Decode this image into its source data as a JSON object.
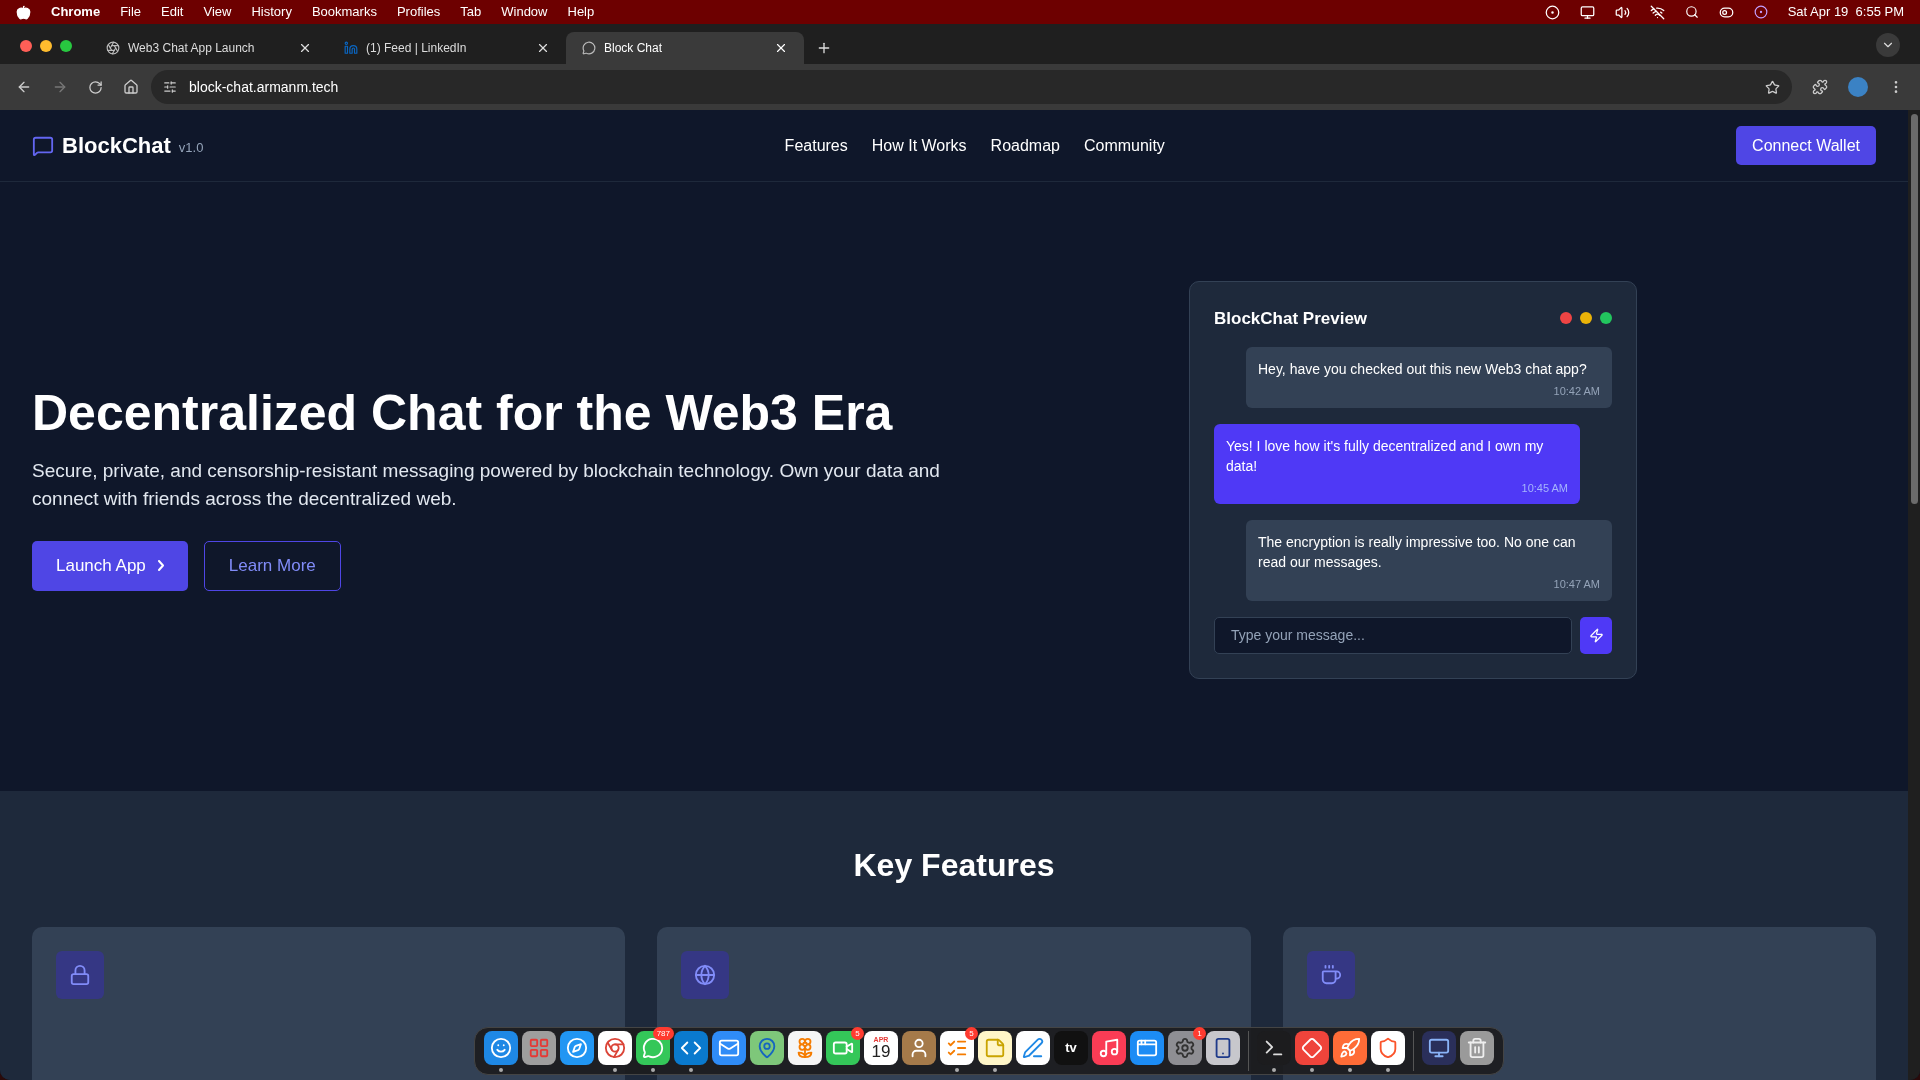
{
  "menu_bar": {
    "app": "Chrome",
    "items": [
      "File",
      "Edit",
      "View",
      "History",
      "Bookmarks",
      "Profiles",
      "Tab",
      "Window",
      "Help"
    ],
    "clock": "Sat Apr 19  6:55 PM"
  },
  "tabs": [
    {
      "title": "Web3 Chat App Launch",
      "kind": "openai",
      "selected": false
    },
    {
      "title": "(1) Feed | LinkedIn",
      "kind": "linkedin",
      "selected": false
    },
    {
      "title": "Block Chat",
      "kind": "chat",
      "selected": true
    }
  ],
  "address": "block-chat.armanm.tech",
  "nav": {
    "brand": "BlockChat",
    "version": "v1.0",
    "links": [
      "Features",
      "How It Works",
      "Roadmap",
      "Community"
    ],
    "cta": "Connect Wallet"
  },
  "hero": {
    "title": "Decentralized Chat for the Web3 Era",
    "subtitle": "Secure, private, and censorship-resistant messaging powered by blockchain technology. Own your data and connect with friends across the decentralized web.",
    "primary": "Launch App",
    "secondary": "Learn More"
  },
  "preview": {
    "title": "BlockChat Preview",
    "messages": [
      {
        "text": "Hey, have you checked out this new Web3 chat app?",
        "time": "10:42 AM",
        "mine": false
      },
      {
        "text": "Yes! I love how it's fully decentralized and I own my data!",
        "time": "10:45 AM",
        "mine": true
      },
      {
        "text": "The encryption is really impressive too. No one can read our messages.",
        "time": "10:47 AM",
        "mine": false
      }
    ],
    "placeholder": "Type your message..."
  },
  "features": {
    "title": "Key Features",
    "cards": [
      {
        "kind": "lock"
      },
      {
        "kind": "globe"
      },
      {
        "kind": "cup"
      }
    ]
  },
  "dock": [
    {
      "kind": "finder",
      "color": "#1e88e5",
      "running": true
    },
    {
      "kind": "launchpad",
      "color": "#9e9e9e",
      "running": false
    },
    {
      "kind": "safari",
      "color": "#2196f3",
      "running": false
    },
    {
      "kind": "chrome",
      "color": "#ffffff",
      "running": true
    },
    {
      "kind": "messages",
      "color": "#34c759",
      "running": true,
      "badge": "787"
    },
    {
      "kind": "code",
      "color": "#0a7ace",
      "running": true
    },
    {
      "kind": "mail",
      "color": "#2f8cf7",
      "running": false
    },
    {
      "kind": "maps",
      "color": "#7ec77a",
      "running": false
    },
    {
      "kind": "photos",
      "color": "#f5f5f5",
      "running": false
    },
    {
      "kind": "facetime",
      "color": "#34c759",
      "running": false,
      "badge": "5"
    },
    {
      "kind": "calendar",
      "color": "#ffffff",
      "running": false,
      "month": "APR",
      "day": "19"
    },
    {
      "kind": "contacts",
      "color": "#a57a4a",
      "running": false
    },
    {
      "kind": "reminders",
      "color": "#ffffff",
      "running": true,
      "badge": "5"
    },
    {
      "kind": "notes",
      "color": "#fff6c8",
      "running": true
    },
    {
      "kind": "freeform",
      "color": "#ffffff",
      "running": false
    },
    {
      "kind": "tv",
      "color": "#111111",
      "running": false,
      "label": "tv"
    },
    {
      "kind": "music",
      "color": "#fa3c55",
      "running": false
    },
    {
      "kind": "appstore",
      "color": "#1c8cf5",
      "running": false
    },
    {
      "kind": "settings",
      "color": "#8e8e93",
      "running": false,
      "badge": "1"
    },
    {
      "kind": "phone",
      "color": "#c7c7cc",
      "running": false
    },
    {
      "kind": "separator"
    },
    {
      "kind": "terminal",
      "color": "#1c1c1e",
      "running": true
    },
    {
      "kind": "remote",
      "color": "#ef443b",
      "running": true
    },
    {
      "kind": "postman",
      "color": "#ff6c37",
      "running": true
    },
    {
      "kind": "brave",
      "color": "#ffffff",
      "running": true
    },
    {
      "kind": "separator"
    },
    {
      "kind": "window",
      "color": "#2a2f5a",
      "running": false
    },
    {
      "kind": "trash",
      "color": "#9a9a9a",
      "running": false
    }
  ]
}
